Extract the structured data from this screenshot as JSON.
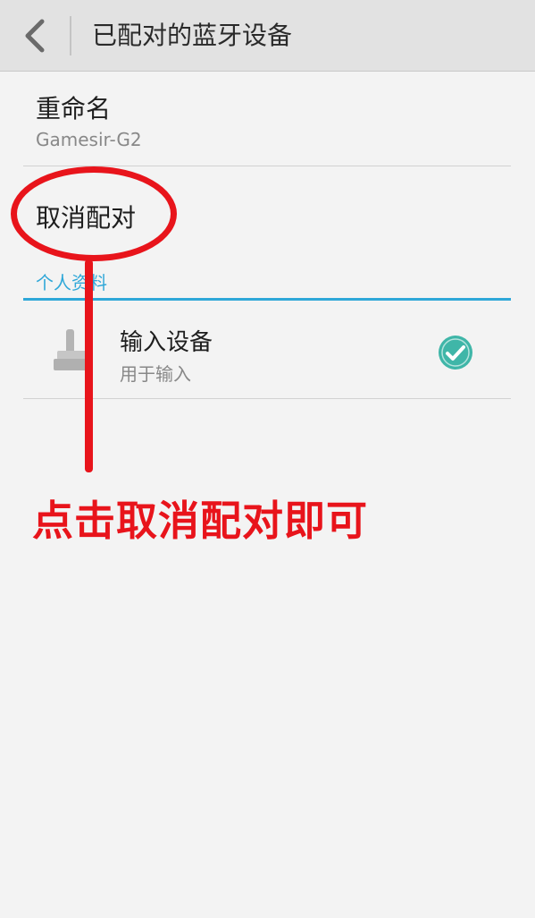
{
  "header": {
    "title": "已配对的蓝牙设备",
    "back_icon": "chevron-left-icon"
  },
  "rename": {
    "title": "重命名",
    "device_name": "Gamesir-G2"
  },
  "unpair": {
    "title": "取消配对"
  },
  "profiles": {
    "section_title": "个人资料",
    "items": [
      {
        "title": "输入设备",
        "subtitle": "用于输入",
        "icon": "joystick-icon",
        "checked": true
      }
    ]
  },
  "annotation": {
    "text": "点击取消配对即可",
    "color": "#e8141b"
  },
  "colors": {
    "accent": "#2ea7d8",
    "check": "#3fb6a8"
  }
}
